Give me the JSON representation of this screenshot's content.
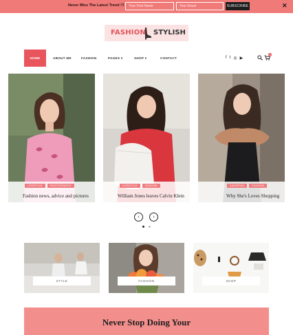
{
  "topbar": {
    "promo_text": "Never Miss The Latest Trend !!!",
    "name_placeholder": "Your First Name",
    "email_placeholder": "Your Email",
    "subscribe_label": "SUBSCRIBE",
    "close_glyph": "✕",
    "bg_color": "#f07a78"
  },
  "logo": {
    "part1": "FASHION",
    "part2": "STYLISH"
  },
  "nav": {
    "items": [
      {
        "label": "HOME",
        "active": true
      },
      {
        "label": "ABOUT ME",
        "active": false
      },
      {
        "label": "FASHION",
        "active": false
      },
      {
        "label": "PAGES ▾",
        "active": false
      },
      {
        "label": "SHOP ▾",
        "active": false
      },
      {
        "label": "CONTACT",
        "active": false
      }
    ],
    "social_icons": [
      "facebook-icon",
      "twitter-icon",
      "instagram-icon",
      "youtube-icon"
    ],
    "social_glyphs": [
      "f",
      "t",
      "◎",
      "▶"
    ],
    "cart_count": "0",
    "accent_color": "#e8555d"
  },
  "slides": [
    {
      "tags": [
        "LIFESTYLE",
        "PHOTOGRAPHY"
      ],
      "title": "Fashion news, advice and pictures"
    },
    {
      "tags": [
        "LIFESTYLE",
        "FASHION"
      ],
      "title": "William Jones leaves Calvin Klein"
    },
    {
      "tags": [
        "SHOPPING",
        "FASHION"
      ],
      "title": "Why She's Loves Shopping"
    }
  ],
  "slider_nav": {
    "prev_glyph": "‹",
    "next_glyph": "›"
  },
  "categories": [
    {
      "label": "STYLE"
    },
    {
      "label": "FASHION"
    },
    {
      "label": "SHOP"
    }
  ],
  "newsletter": {
    "heading": "Never Stop Doing Your"
  }
}
